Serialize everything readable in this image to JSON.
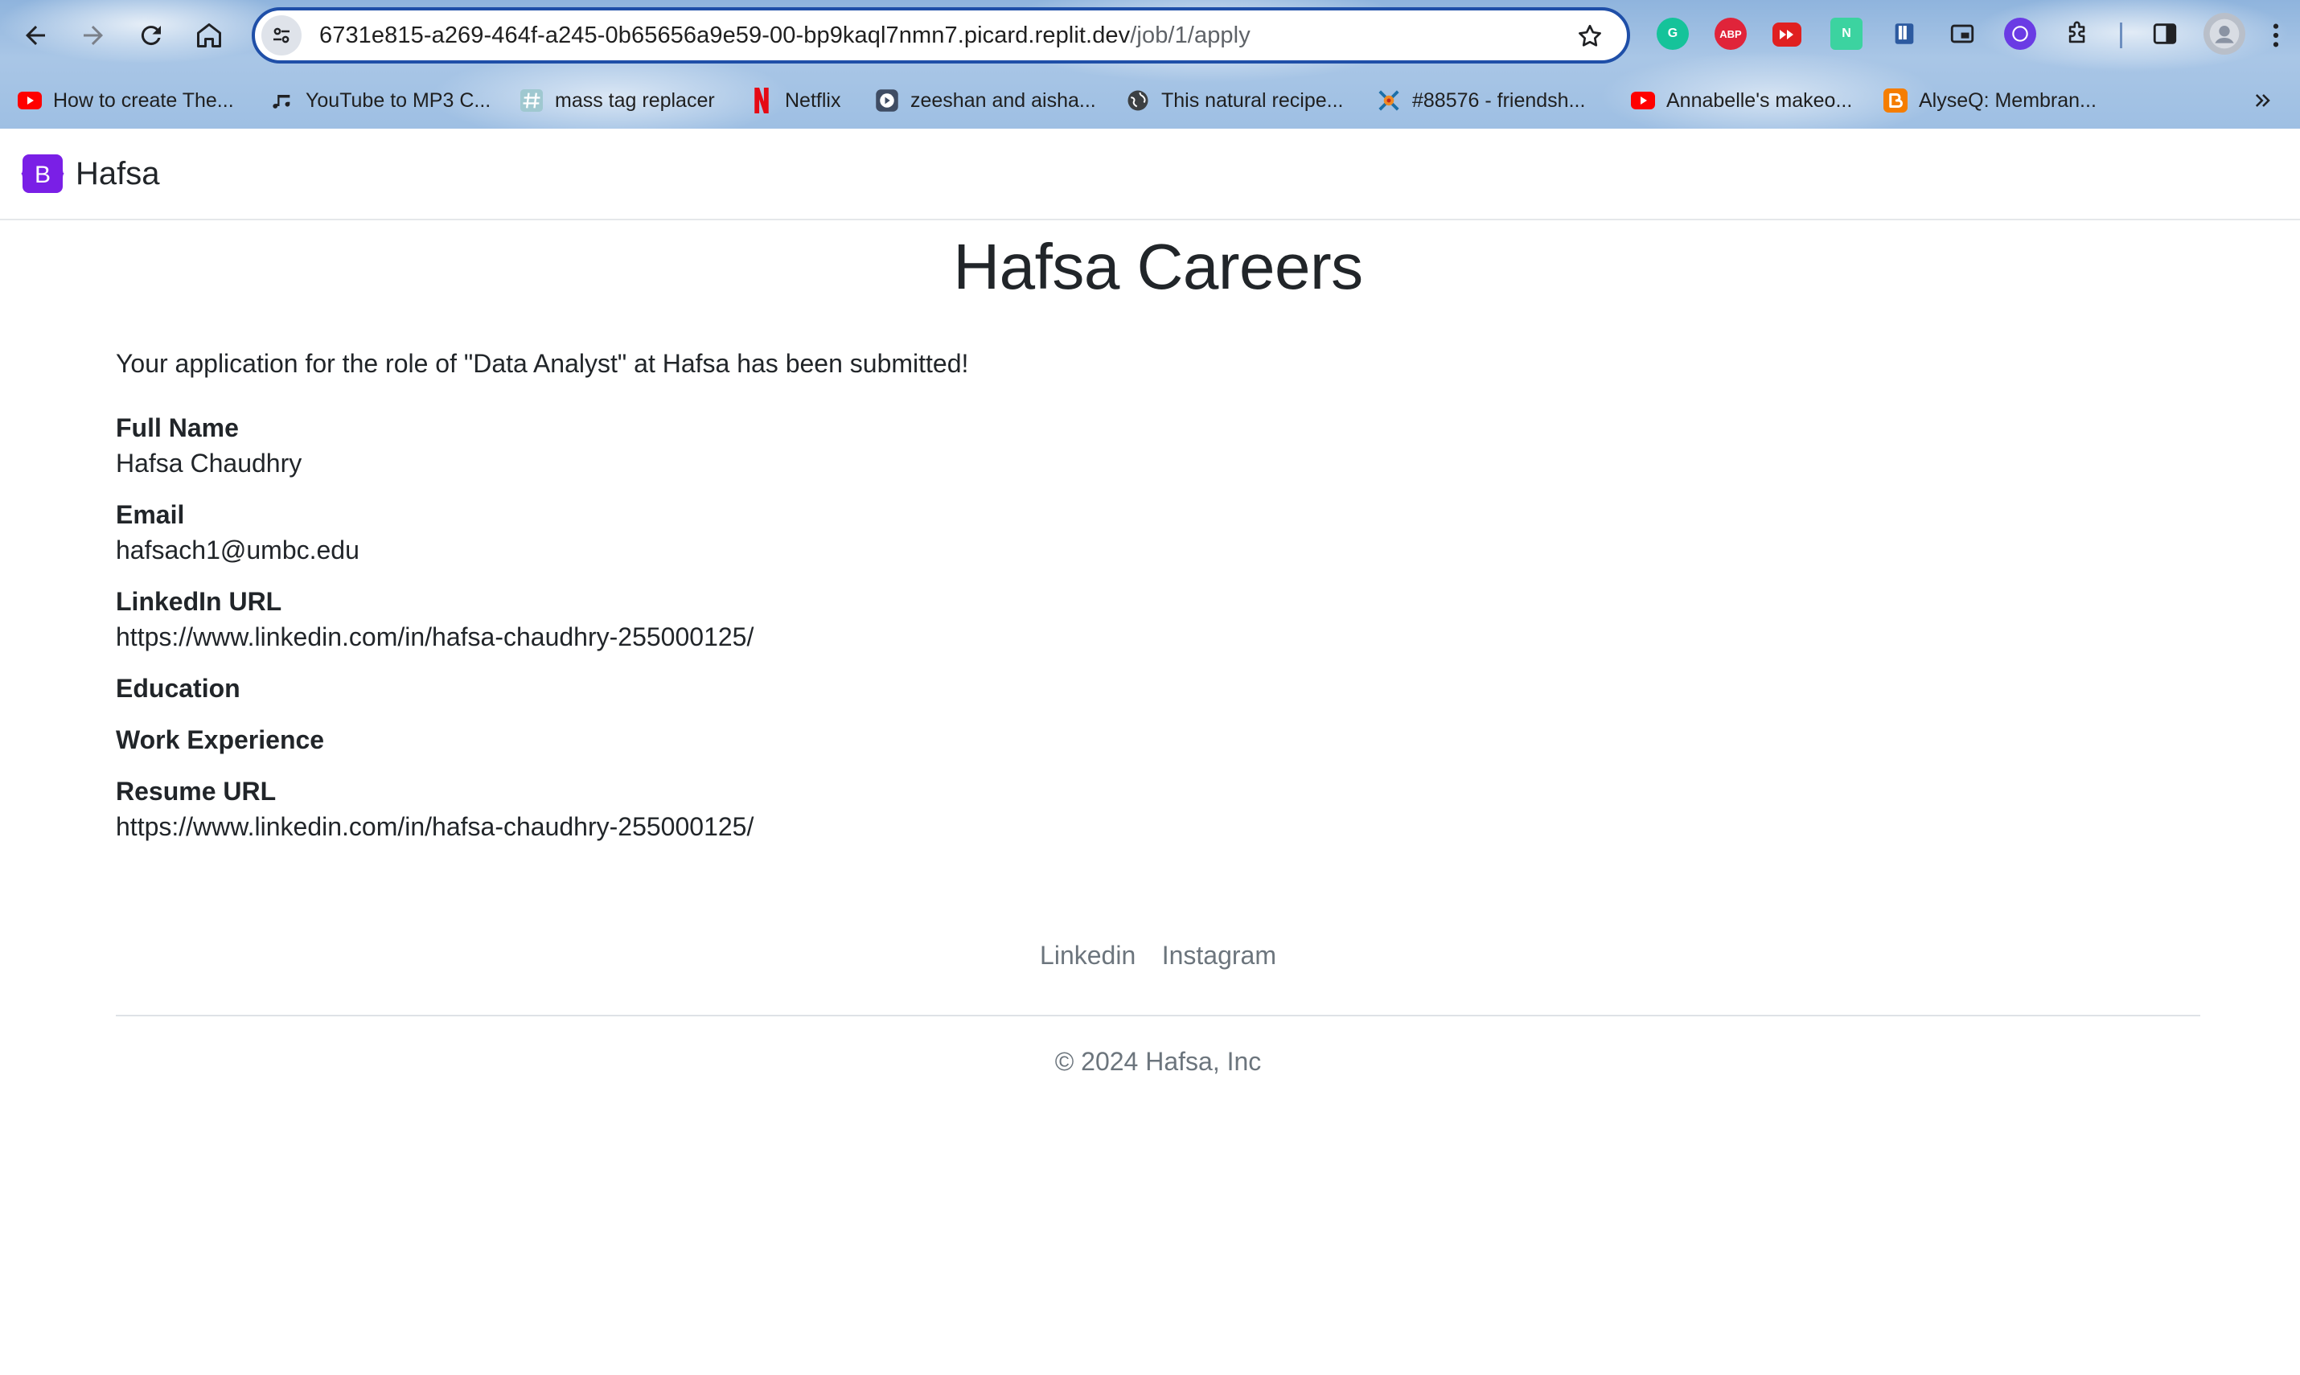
{
  "browser": {
    "url_host": "6731e815-a269-464f-a245-0b65656a9e59-00-bp9kaql7nmn7.picard.replit.dev",
    "url_path": "/job/1/apply",
    "bookmarks": [
      {
        "label": "How to create The...",
        "icon": "youtube-icon"
      },
      {
        "label": "YouTube to MP3 C...",
        "icon": "music-note-icon"
      },
      {
        "label": "mass tag replacer",
        "icon": "hashtag-icon"
      },
      {
        "label": "Netflix",
        "icon": "netflix-icon"
      },
      {
        "label": "zeeshan and aisha...",
        "icon": "video-play-icon"
      },
      {
        "label": "This natural recipe...",
        "icon": "globe-icon"
      },
      {
        "label": "#88576 - friendsh...",
        "icon": "bracelet-icon"
      },
      {
        "label": "Annabelle's makeo...",
        "icon": "youtube-icon"
      },
      {
        "label": "AlyseQ: Membran...",
        "icon": "blogger-icon"
      }
    ],
    "extensions": {
      "grammarly": "G",
      "adblock": "ABP",
      "notion": "N"
    },
    "colors": {
      "omnibox_border": "#1f4fa8",
      "youtube_red": "#ff0000",
      "netflix_red": "#e50914",
      "blogger_orange": "#f57d00"
    }
  },
  "site": {
    "brand": "Hafsa",
    "brand_logo_letter": "B",
    "brand_color": "#7a1fe6"
  },
  "main": {
    "title": "Hafsa Careers",
    "confirmation": "Your application for the role of \"Data Analyst\" at Hafsa has been submitted!",
    "fields": [
      {
        "label": "Full Name",
        "value": "Hafsa Chaudhry"
      },
      {
        "label": "Email",
        "value": "hafsach1@umbc.edu"
      },
      {
        "label": "LinkedIn URL",
        "value": "https://www.linkedin.com/in/hafsa-chaudhry-255000125/"
      },
      {
        "label": "Education",
        "value": ""
      },
      {
        "label": "Work Experience",
        "value": ""
      },
      {
        "label": "Resume URL",
        "value": "https://www.linkedin.com/in/hafsa-chaudhry-255000125/"
      }
    ]
  },
  "footer": {
    "links": [
      "Linkedin",
      "Instagram"
    ],
    "copyright": "© 2024 Hafsa, Inc"
  }
}
